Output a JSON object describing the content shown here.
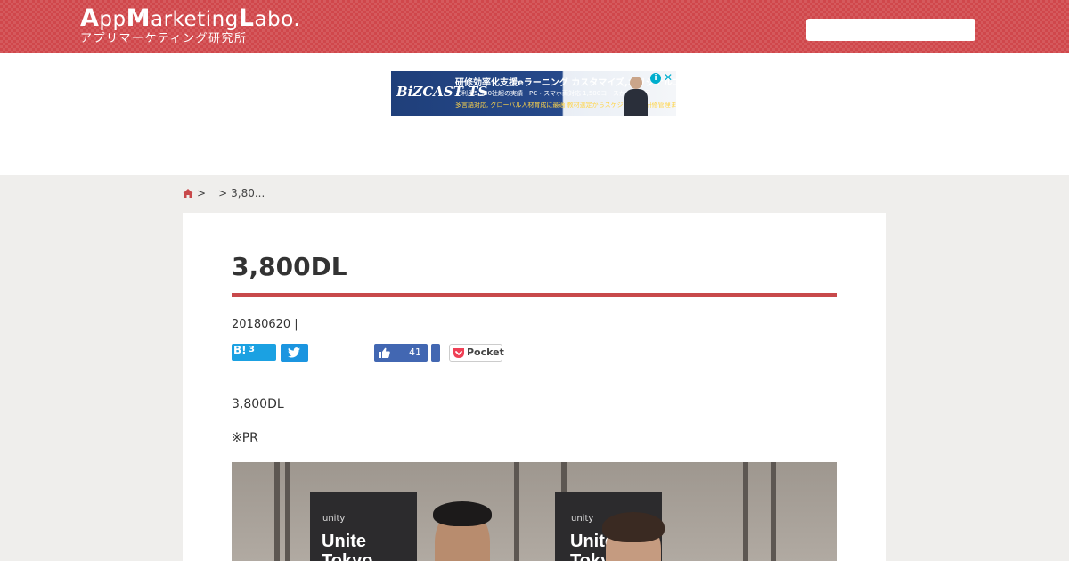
{
  "header": {
    "logo_main_parts": [
      "A",
      "pp",
      "M",
      "arketing",
      "L",
      "abo."
    ],
    "logo_sub": "アプリマーケティング研究所",
    "search_placeholder": ""
  },
  "ad": {
    "logo_text": "BiZCAST TS",
    "headline": "研修効率化支援eラーニング カスタマイズ,オリジナルコース",
    "line2": "ご利用5,500社超の実績　PC・スマホ両対応 1,500コースからご提案",
    "line3": "多言語対応, グローバル人材育成に最適 教材選定からスケジュール, 研修管理までサポート",
    "info_icon": "i",
    "close_icon": "✕"
  },
  "breadcrumb": {
    "sep1": ">",
    "sep2": ">",
    "current": "3,80..."
  },
  "article": {
    "title": "3,800DL",
    "date": "20180620 |",
    "para1": "3,800DL",
    "para2": "※PR"
  },
  "share": {
    "hatena_label": "B!",
    "hatena_count": "3",
    "like_count": "41",
    "pocket_label": "Pocket"
  },
  "photo": {
    "banner_brand": "unity",
    "banner_line1": "Unite",
    "banner_line2": "Tokyo"
  },
  "colors": {
    "brand_red": "#d0474b",
    "title_rule": "#c8494b",
    "hatena_blue": "#1ba1e2",
    "twitter_blue": "#1b95e0",
    "facebook_blue": "#4267b2",
    "pocket_red": "#ef4056"
  }
}
